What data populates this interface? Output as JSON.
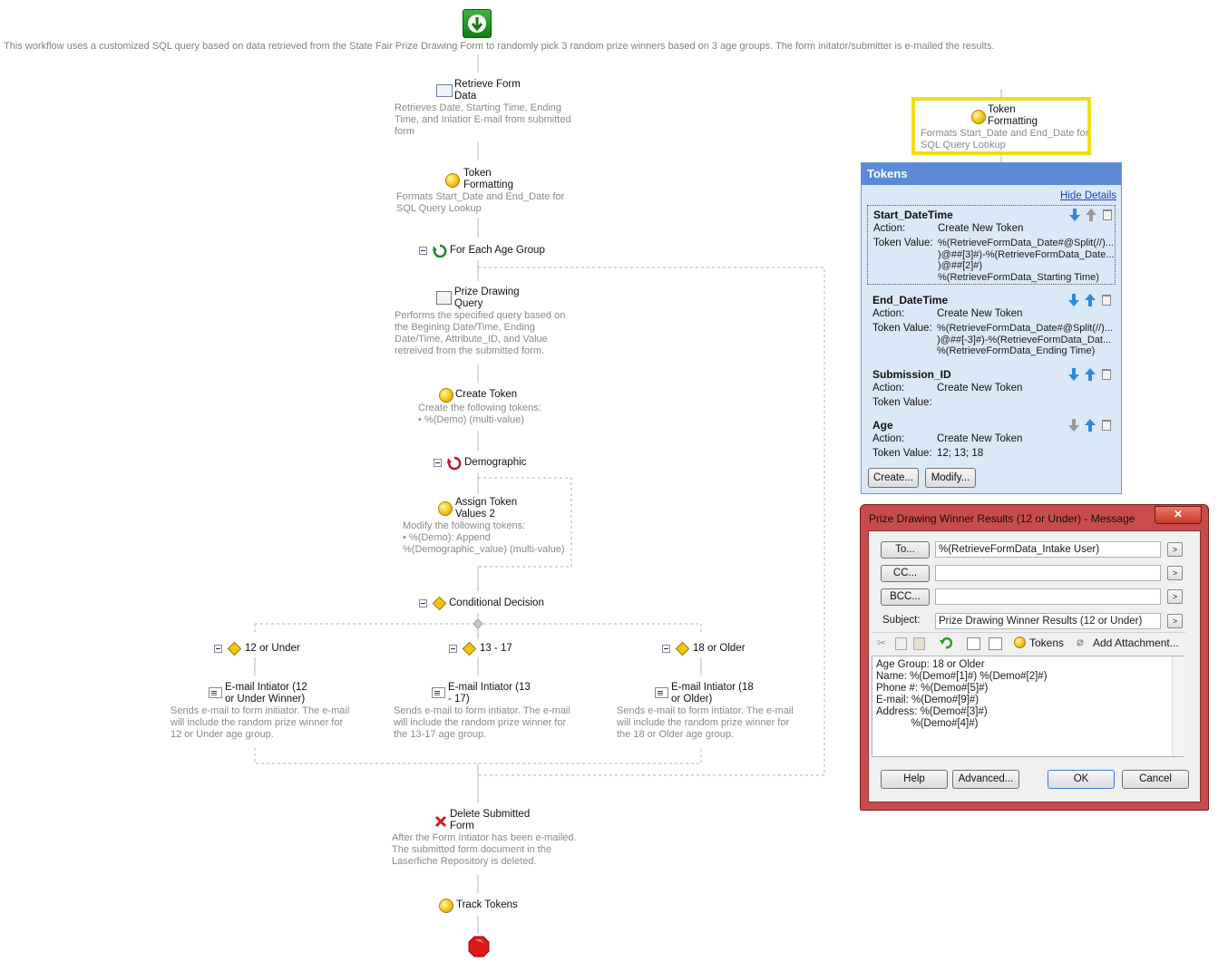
{
  "workflow": {
    "description": "This workflow uses a customized SQL query based on data retrieved from the State Fair Prize Drawing Form to randomly pick 3 random prize winners based on 3 age groups. The form initator/submitter is e-mailed the results.",
    "nodes": {
      "retrieve": {
        "title1": "Retrieve Form",
        "title2": "Data",
        "desc1": "Retrieves Date, Starting Time, Ending",
        "desc2": "Time, and Iniatior E-mail from submitted",
        "desc3": "form"
      },
      "token_formatting": {
        "title1": "Token",
        "title2": "Formatting",
        "desc1": "Formats Start_Date and End_Date for",
        "desc2": "SQL Query Lookup"
      },
      "for_each": {
        "title": "For Each Age Group"
      },
      "prize_query": {
        "title1": "Prize Drawing",
        "title2": "Query",
        "desc1": "Performs the specified query based on",
        "desc2": "the Begining Date/Time, Ending",
        "desc3": "Date/Time, Attribute_ID, and Value",
        "desc4": "retreived from the submitted form."
      },
      "create_token": {
        "title": "Create Token",
        "desc1": "Create the following tokens:",
        "desc2": "• %(Demo) (multi-value)"
      },
      "demographic": {
        "title": "Demographic"
      },
      "assign_token": {
        "title1": "Assign Token",
        "title2": "Values 2",
        "desc1": "Modify the following tokens:",
        "desc2": "• %(Demo): Append",
        "desc3": "%(Demographic_value) (multi-value)"
      },
      "conditional": {
        "title": "Conditional Decision"
      },
      "branches": [
        {
          "label": "12 or Under",
          "email1": "E-mail Intiator (12",
          "email2": "or Under Winner)",
          "desc1": "Sends e-mail to form initiator. The e-mail",
          "desc2": "will include the random prize winner for",
          "desc3": "12 or Under age group."
        },
        {
          "label": "13 - 17",
          "email1": "E-mail Intiator (13",
          "email2": "- 17)",
          "desc1": "Sends e-mail to form intiator. The e-mail",
          "desc2": "will include the random prize winner for",
          "desc3": "the 13-17 age group."
        },
        {
          "label": "18 or Older",
          "email1": "E-mail Intiator (18",
          "email2": "or Older)",
          "desc1": "Sends e-mail to form intiator. The e-mail",
          "desc2": "will include the random prize winner for",
          "desc3": "the 18 or Older age group."
        }
      ],
      "delete": {
        "title1": "Delete Submitted",
        "title2": "Form",
        "desc1": "After the Form Intiator has been e-mailed.",
        "desc2": "The submitted form document in the",
        "desc3": "Laserfiche Repository is deleted."
      },
      "track": {
        "title": "Track Tokens"
      }
    }
  },
  "highlight_node": {
    "title1": "Token",
    "title2": "Formatting",
    "desc1": "Formats Start_Date and End_Date for",
    "desc2": "SQL Query Lookup"
  },
  "tokens_panel": {
    "header": "Tokens",
    "hide_details": "Hide Details",
    "action_label": "Action:",
    "value_label": "Token Value:",
    "tokens": [
      {
        "name": "Start_DateTime",
        "action": "Create New Token",
        "value1": "%(RetrieveFormData_Date#@Split(//)...",
        "value2": ")@##[3]#)-%(RetrieveFormData_Date...",
        "value3": ")@##[2]#)",
        "value4": "%(RetrieveFormData_Starting Time)"
      },
      {
        "name": "End_DateTime",
        "action": "Create New Token",
        "value1": "%(RetrieveFormData_Date#@Split(//)...",
        "value2": ")@##[-3]#)-%(RetrieveFormData_Dat...",
        "value3": "%(RetrieveFormData_Ending Time)"
      },
      {
        "name": "Submission_ID",
        "action": "Create New Token",
        "value1": ""
      },
      {
        "name": "Age",
        "action": "Create New Token",
        "value1": "12; 13; 18"
      }
    ],
    "create_button": "Create...",
    "modify_button": "Modify..."
  },
  "email_dialog": {
    "title": "Prize Drawing Winner Results (12 or Under) - Message",
    "to_button": "To...",
    "to_value": "%(RetrieveFormData_Intake User)",
    "cc_button": "CC...",
    "cc_value": "",
    "bcc_button": "BCC...",
    "bcc_value": "",
    "subject_label": "Subject:",
    "subject_value": "Prize Drawing Winner Results (12 or Under)",
    "go_symbol": ">",
    "tokens_button": "Tokens",
    "attachment_button": "Add Attachment...",
    "body_lines": [
      "Age Group: 18 or Older",
      "Name: %(Demo#[1]#) %(Demo#[2]#)",
      "Phone #: %(Demo#[5]#)",
      "E-mail: %(Demo#[9]#)",
      "Address: %(Demo#[3]#)",
      "            %(Demo#[4]#)"
    ],
    "help_button": "Help",
    "advanced_button": "Advanced...",
    "ok_button": "OK",
    "cancel_button": "Cancel",
    "close_symbol": "✕"
  }
}
